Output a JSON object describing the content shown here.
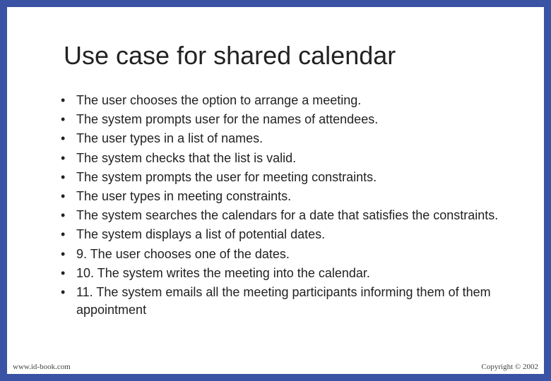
{
  "title": "Use case for shared calendar",
  "bullets": [
    "The user chooses the option to arrange a meeting.",
    "The system prompts user for the names of attendees.",
    "The user types in a list of names.",
    "The system checks that the list is valid.",
    "The system prompts the user for meeting constraints.",
    "The user types in meeting constraints.",
    "The system searches the calendars for a date that satisfies the constraints.",
    "The system displays a list of potential dates.",
    "9. The user chooses one of the dates.",
    "10. The system writes the meeting into the calendar.",
    "11. The system emails all the meeting participants informing them of them appointment"
  ],
  "footer": {
    "left": "www.id-book.com",
    "right": "Copyright © 2002"
  }
}
